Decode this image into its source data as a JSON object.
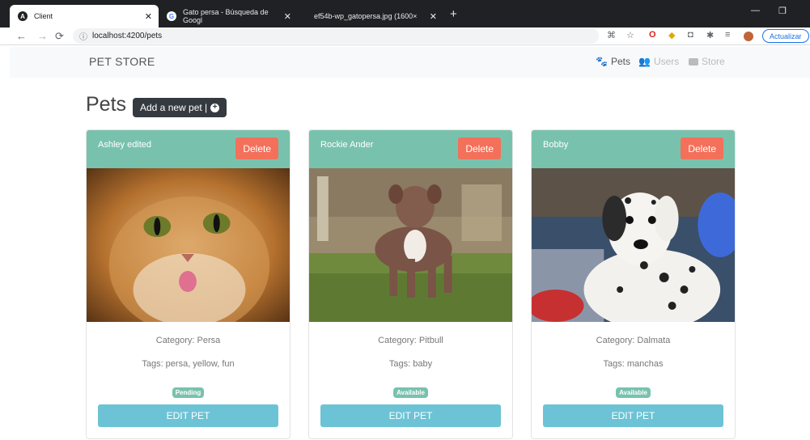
{
  "browser": {
    "tabs": [
      {
        "title": "Client",
        "favicon": "angular-icon",
        "active": true
      },
      {
        "title": "Gato persa - Búsqueda de Googl",
        "favicon": "google-icon",
        "active": false
      },
      {
        "title": "ef54b-wp_gatopersa.jpg (1600×",
        "favicon": "image-icon",
        "active": false
      }
    ],
    "url": "localhost:4200/pets",
    "update_label": "Actualizar",
    "colors": {
      "tabbar": "#202124",
      "accent": "#1a73e8"
    }
  },
  "navbar": {
    "brand": "PET STORE",
    "links": [
      {
        "label": "Pets",
        "icon": "paw-icon",
        "active": true
      },
      {
        "label": "Users",
        "icon": "users-icon",
        "active": false
      },
      {
        "label": "Store",
        "icon": "store-icon",
        "active": false
      }
    ]
  },
  "page": {
    "title": "Pets",
    "add_button": "Add a new pet |"
  },
  "cards": [
    {
      "name": "Ashley edited",
      "delete": "Delete",
      "category": "Category: Persa",
      "tags": "Tags: persa, yellow, fun",
      "status": "Pending",
      "edit": "EDIT PET",
      "image": "persian-cat"
    },
    {
      "name": "Rockie Ander",
      "delete": "Delete",
      "category": "Category: Pitbull",
      "tags": "Tags: baby",
      "status": "Available",
      "edit": "EDIT PET",
      "image": "pitbull-puppy"
    },
    {
      "name": "Bobby",
      "delete": "Delete",
      "category": "Category: Dalmata",
      "tags": "Tags: manchas",
      "status": "Available",
      "edit": "EDIT PET",
      "image": "dalmatian-puppy"
    }
  ],
  "colors": {
    "header": "#78c2ad",
    "delete": "#f3705a",
    "edit": "#6cc3d5",
    "badge": "#78c2ad"
  }
}
